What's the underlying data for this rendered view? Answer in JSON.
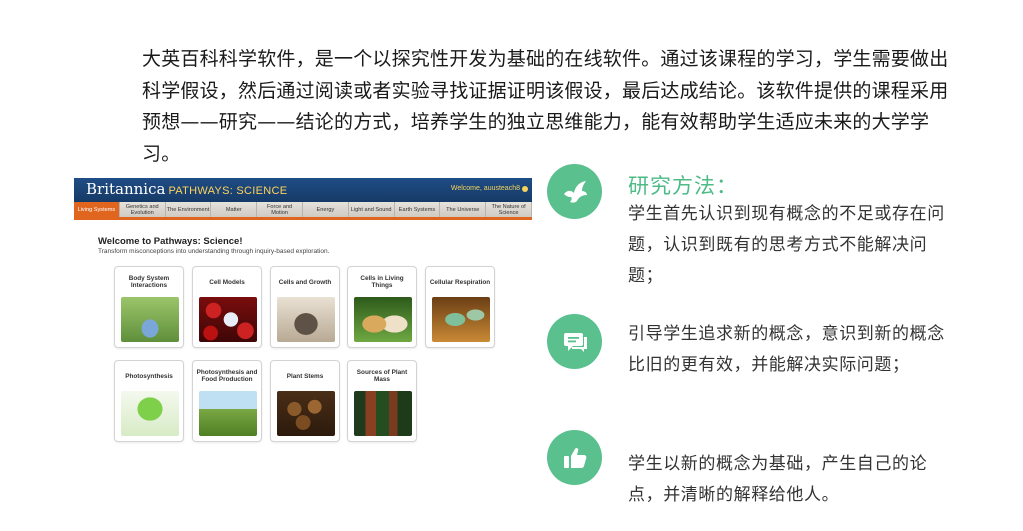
{
  "intro": "大英百科科学软件，是一个以探究性开发为基础的在线软件。通过该课程的学习，学生需要做出科学假设，然后通过阅读或者实验寻找证据证明该假设，最后达成结论。该软件提供的课程采用预想——研究——结论的方式，培养学生的独立思维能力，能有效帮助学生适应未来的大学学习。",
  "screenshot": {
    "brand_logo": "Britannica",
    "brand_product": "PATHWAYS: SCIENCE",
    "welcome_user": "Welcome, auusteach8",
    "tabs": [
      "Living Systems",
      "Genetics and Evolution",
      "The Environment",
      "Matter",
      "Force and Motion",
      "Energy",
      "Light and Sound",
      "Earth Systems",
      "The Universe",
      "The Nature of Science"
    ],
    "welcome_title": "Welcome to Pathways: Science!",
    "welcome_subtitle": "Transform misconceptions into understanding through inquiry-based exploration.",
    "cards": [
      "Body System Interactions",
      "Cell Models",
      "Cells and Growth",
      "Cells in Living Things",
      "Cellular Respiration",
      "Photosynthesis",
      "Photosynthesis and Food Production",
      "Plant Stems",
      "Sources of Plant Mass"
    ]
  },
  "method": {
    "title": "研究方法：",
    "items": [
      {
        "icon": "bird-icon",
        "text": "学生首先认识到现有概念的不足或存在问题，认识到既有的思考方式不能解决问题；"
      },
      {
        "icon": "chat-icon",
        "text": "引导学生追求新的概念，意识到新的概念比旧的更有效，并能解决实际问题；"
      },
      {
        "icon": "thumbs-up-icon",
        "text": "学生以新的概念为基础，产生自己的论点，并清晰的解释给他人。"
      }
    ]
  },
  "colors": {
    "accent": "#59c08e",
    "title": "#4dbb86",
    "nav_active": "#e0661f",
    "header": "#1f4d86"
  }
}
